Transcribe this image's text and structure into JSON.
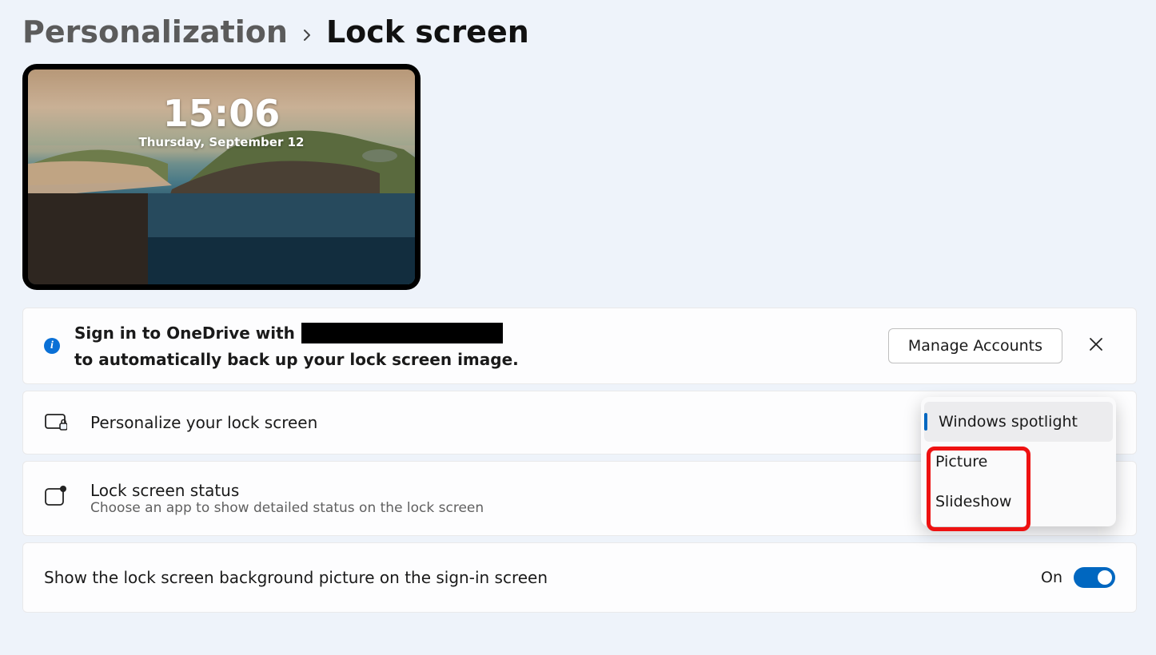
{
  "breadcrumb": {
    "parent": "Personalization",
    "current": "Lock screen"
  },
  "preview": {
    "time": "15:06",
    "date": "Thursday, September 12"
  },
  "banner": {
    "prefix": "Sign in to OneDrive with",
    "suffix": "to automatically back up your lock screen image.",
    "manage": "Manage Accounts"
  },
  "personalize": {
    "title": "Personalize your lock screen",
    "options": [
      "Windows spotlight",
      "Picture",
      "Slideshow"
    ],
    "selected": "Windows spotlight"
  },
  "status": {
    "title": "Lock screen status",
    "subtitle": "Choose an app to show detailed status on the lock screen"
  },
  "signin_bg": {
    "label": "Show the lock screen background picture on the sign-in screen",
    "state": "On"
  }
}
